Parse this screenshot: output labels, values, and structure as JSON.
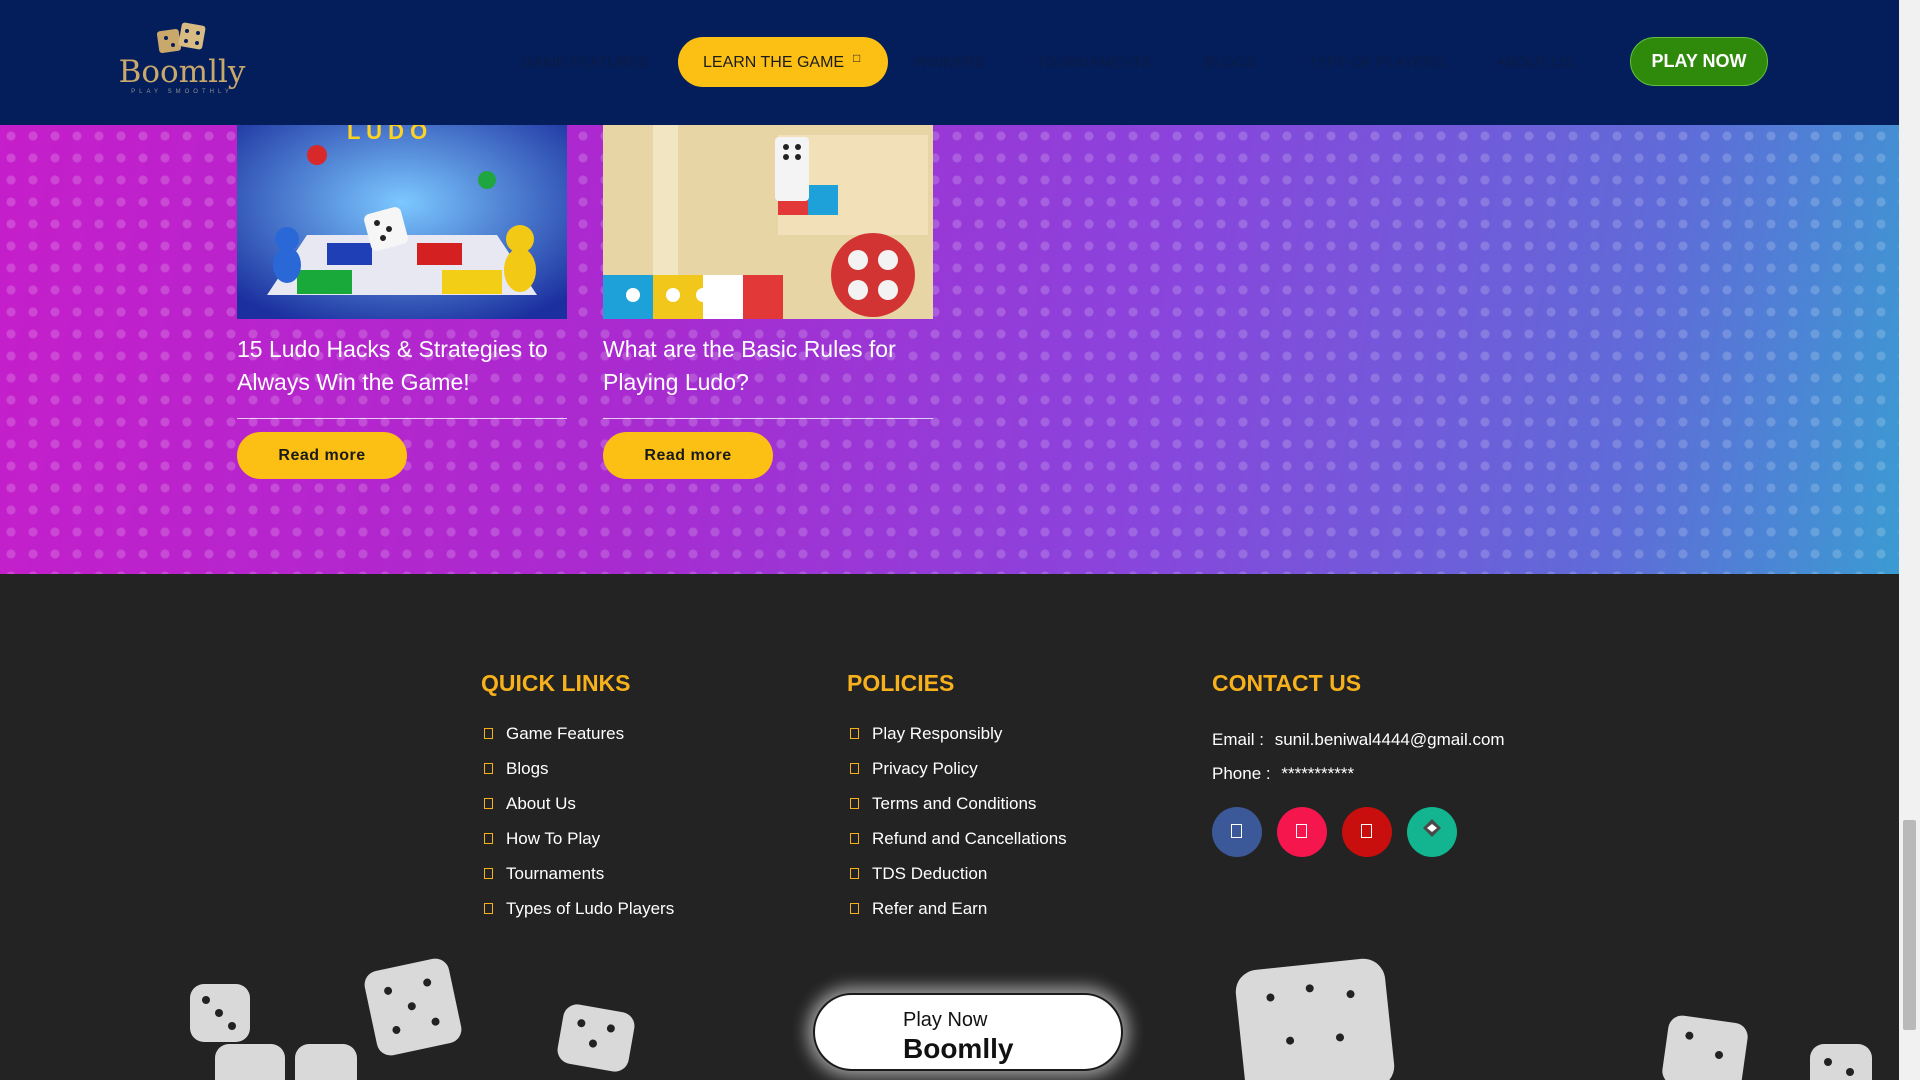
{
  "brand": {
    "name": "Boomlly",
    "tagline": "PLAY SMOOTHLY"
  },
  "nav": {
    "items": [
      "GAME FEATURES",
      "LEARN THE GAME",
      "WINNERS",
      "TOURNAMENTS",
      "BLOGS",
      "TYPE OF PLAYERS",
      "ABOUT US"
    ],
    "active_index": 1,
    "active_caret": "□",
    "play_now": "PLAY NOW"
  },
  "blogs": [
    {
      "title": "15 Ludo Hacks & Strategies to Always Win the Game!",
      "button": "Read more"
    },
    {
      "title": "What are the Basic Rules for Playing Ludo?",
      "button": "Read more"
    }
  ],
  "footer": {
    "quick_links": {
      "title": "QUICK LINKS",
      "items": [
        "Game Features",
        "Blogs",
        "About Us",
        "How To Play",
        "Tournaments",
        "Types of Ludo Players"
      ]
    },
    "policies": {
      "title": "POLICIES",
      "items": [
        "Play Responsibly",
        "Privacy Policy",
        "Terms and Conditions",
        "Refund and Cancellations",
        "TDS Deduction",
        "Refer and Earn"
      ]
    },
    "contact": {
      "title": "CONTACT US",
      "email_label": "Email :",
      "email": "sunil.beniwal4444@gmail.com",
      "phone_label": "Phone :",
      "phone": "***********",
      "social": [
        {
          "name": "facebook-icon",
          "color": "#3b5998"
        },
        {
          "name": "instagram-icon",
          "color": "#f5164d"
        },
        {
          "name": "youtube-icon",
          "color": "#c90e0e"
        },
        {
          "name": "link-icon",
          "color": "#12b58f"
        }
      ]
    },
    "cta": {
      "line1": "Play Now",
      "line2": "Boomlly"
    }
  },
  "colors": {
    "header_bg": "#041e5c",
    "accent_yellow": "#fcc014",
    "play_green": "#2f8a0c",
    "footer_bg": "#232323",
    "footer_heading": "#f6b11c"
  }
}
